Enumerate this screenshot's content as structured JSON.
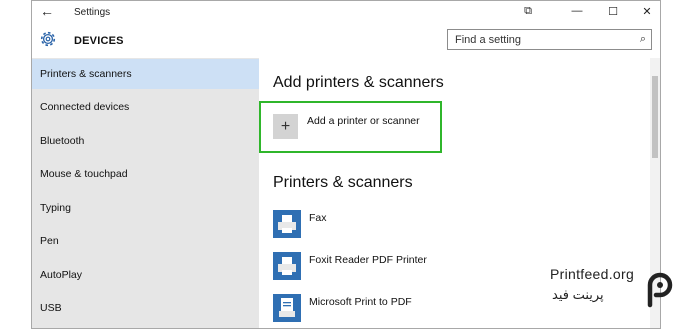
{
  "window": {
    "title": "Settings",
    "back_icon": "←",
    "snap_icon": "⧉",
    "minimize_icon": "—",
    "maximize_icon": "☐",
    "close_icon": "✕"
  },
  "header": {
    "section_title": "DEVICES",
    "search_placeholder": "Find a setting",
    "search_icon": "⌕"
  },
  "sidebar": {
    "items": [
      {
        "label": "Printers & scanners",
        "active": true
      },
      {
        "label": "Connected devices",
        "active": false
      },
      {
        "label": "Bluetooth",
        "active": false
      },
      {
        "label": "Mouse & touchpad",
        "active": false
      },
      {
        "label": "Typing",
        "active": false
      },
      {
        "label": "Pen",
        "active": false
      },
      {
        "label": "AutoPlay",
        "active": false
      },
      {
        "label": "USB",
        "active": false
      }
    ]
  },
  "main": {
    "add_heading": "Add printers & scanners",
    "add_button_label": "Add a printer or scanner",
    "add_button_icon": "+",
    "printers_heading": "Printers & scanners",
    "devices": [
      {
        "name": "Fax",
        "icon": "printer-icon"
      },
      {
        "name": "Foxit Reader PDF Printer",
        "icon": "printer-icon"
      },
      {
        "name": "Microsoft Print to PDF",
        "icon": "document-printer-icon"
      }
    ]
  },
  "watermark": {
    "text": "Printfeed.org",
    "text_fa": "پرینت فید"
  },
  "colors": {
    "highlight": "#2fb62b",
    "sidebar_bg": "#e6e6e6",
    "sidebar_active": "#cde0f5",
    "device_icon": "#2f6fb3"
  }
}
